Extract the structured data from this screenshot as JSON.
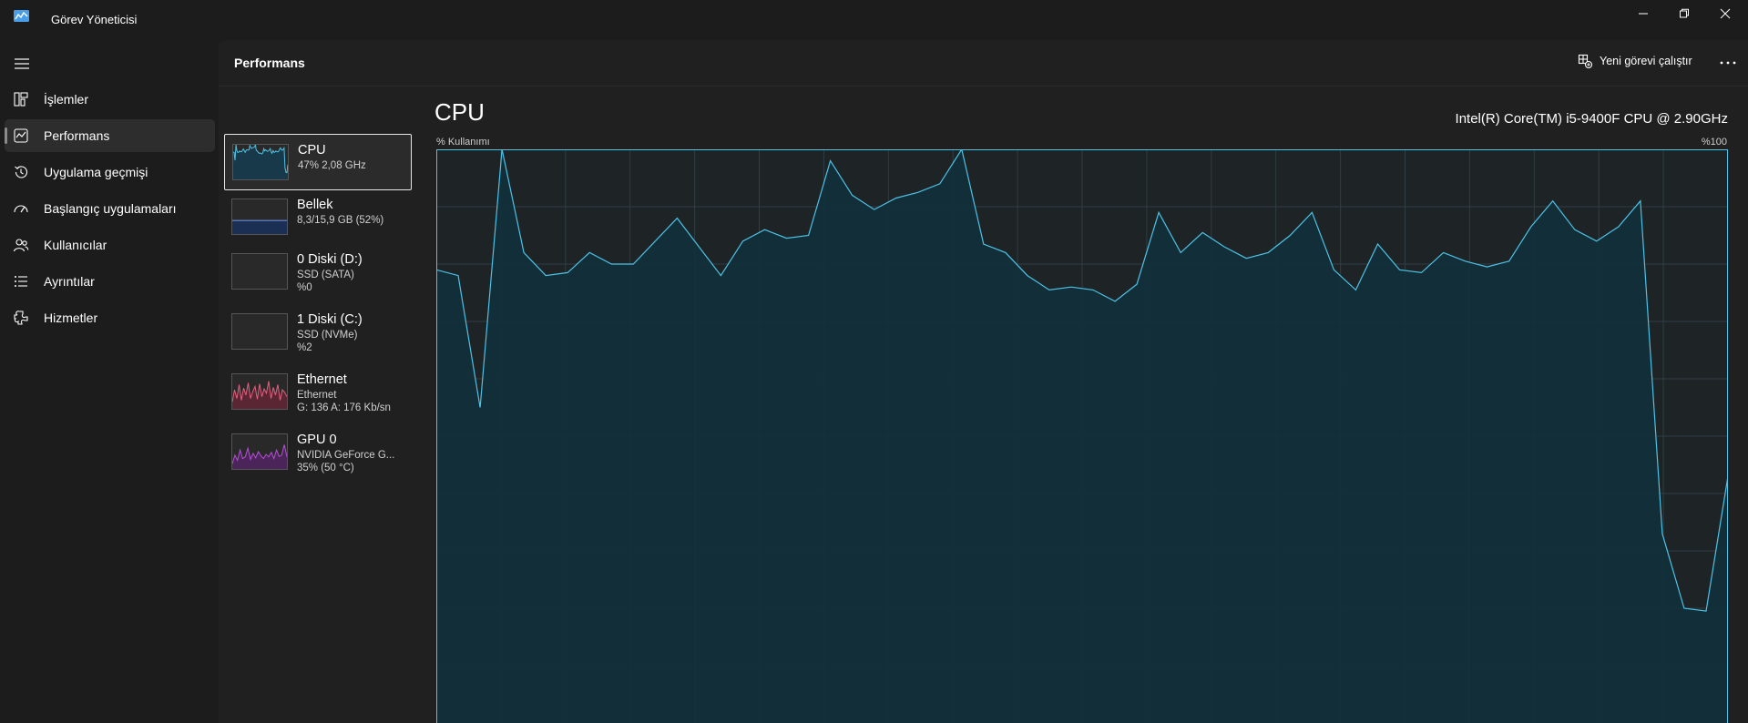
{
  "app": {
    "title": "Görev Yöneticisi",
    "icon": "task-manager-icon"
  },
  "window_controls": [
    "minimize-icon",
    "restore-icon",
    "close-icon"
  ],
  "nav": {
    "items": [
      {
        "label": "İşlemler",
        "icon": "processes-icon",
        "active": false
      },
      {
        "label": "Performans",
        "icon": "performance-icon",
        "active": true
      },
      {
        "label": "Uygulama geçmişi",
        "icon": "history-icon",
        "active": false
      },
      {
        "label": "Başlangıç uygulamaları",
        "icon": "startup-icon",
        "active": false
      },
      {
        "label": "Kullanıcılar",
        "icon": "users-icon",
        "active": false
      },
      {
        "label": "Ayrıntılar",
        "icon": "details-icon",
        "active": false
      },
      {
        "label": "Hizmetler",
        "icon": "services-icon",
        "active": false
      }
    ]
  },
  "header": {
    "title": "Performans",
    "run_task_label": "Yeni görevi çalıştır",
    "more_icon": "more-icon"
  },
  "resources": [
    {
      "name": "CPU",
      "sub1": "47%  2,08 GHz",
      "sub2": "",
      "selected": true,
      "color": "#4cc2e6"
    },
    {
      "name": "Bellek",
      "sub1": "8,3/15,9 GB (52%)",
      "sub2": "",
      "selected": false,
      "color": "#6a8fd8",
      "fill_fraction": 0.52
    },
    {
      "name": "0 Diski (D:)",
      "sub1": "SSD (SATA)",
      "sub2": "%0",
      "selected": false,
      "color": "#6ca03a"
    },
    {
      "name": "1 Diski (C:)",
      "sub1": "SSD (NVMe)",
      "sub2": "%2",
      "selected": false,
      "color": "#6ca03a"
    },
    {
      "name": "Ethernet",
      "sub1": "Ethernet",
      "sub2": "G: 136  A: 176 Kb/sn",
      "selected": false,
      "color": "#e0607e"
    },
    {
      "name": "GPU 0",
      "sub1": "NVIDIA GeForce G...",
      "sub2": "35%  (50 °C)",
      "selected": false,
      "color": "#b54fd6"
    }
  ],
  "graph": {
    "title": "CPU",
    "model": "Intel(R) Core(TM) i5-9400F CPU @ 2.90GHz",
    "y_label": "% Kullanımı",
    "y_max_label": "%100"
  },
  "colors": {
    "cpu_line": "#4cc2e6",
    "cpu_fill": "#12303a",
    "grid": "#2e3e45"
  },
  "chart_data": {
    "type": "area",
    "ylim": [
      0,
      100
    ],
    "grid": true,
    "values": [
      79,
      78,
      55,
      100,
      82,
      78,
      78.5,
      82,
      80,
      80,
      84,
      88,
      83,
      78,
      84,
      86,
      84.5,
      85,
      98,
      92,
      89.5,
      91.5,
      92.5,
      94,
      100,
      83.5,
      82,
      78,
      75.5,
      76,
      75.5,
      73.5,
      76.5,
      89,
      82,
      85.5,
      83,
      81,
      82,
      85,
      89,
      79,
      75.5,
      83.5,
      79,
      78.5,
      82,
      80.5,
      79.5,
      80.5,
      86.5,
      91,
      86,
      84,
      86.5,
      91,
      33,
      20,
      19.5,
      43
    ]
  }
}
